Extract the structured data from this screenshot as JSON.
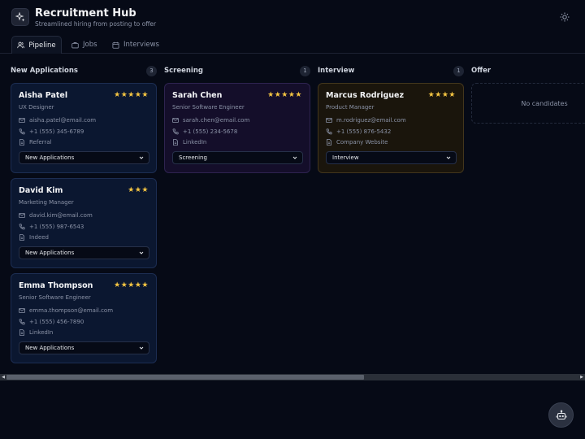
{
  "app": {
    "title": "Recruitment Hub",
    "subtitle": "Streamlined hiring from posting to offer"
  },
  "tabs": [
    {
      "label": "Pipeline",
      "active": true,
      "icon": "users-icon"
    },
    {
      "label": "Jobs",
      "active": false,
      "icon": "briefcase-icon"
    },
    {
      "label": "Interviews",
      "active": false,
      "icon": "calendar-icon"
    }
  ],
  "columns": [
    {
      "title": "New Applications",
      "count": "3"
    },
    {
      "title": "Screening",
      "count": "1"
    },
    {
      "title": "Interview",
      "count": "1"
    },
    {
      "title": "Offer",
      "empty_text": "No candidates"
    }
  ],
  "candidates": [
    {
      "name": "Aisha Patel",
      "role": "UX Designer",
      "email": "aisha.patel@email.com",
      "phone": "+1 (555) 345-6789",
      "source": "Referral",
      "stars": "★★★★★",
      "rating": 5,
      "stage": "New Applications"
    },
    {
      "name": "David Kim",
      "role": "Marketing Manager",
      "email": "david.kim@email.com",
      "phone": "+1 (555) 987-6543",
      "source": "Indeed",
      "stars": "★★★",
      "rating": 3,
      "stage": "New Applications"
    },
    {
      "name": "Emma Thompson",
      "role": "Senior Software Engineer",
      "email": "emma.thompson@email.com",
      "phone": "+1 (555) 456-7890",
      "source": "LinkedIn",
      "stars": "★★★★★",
      "rating": 5,
      "stage": "New Applications"
    },
    {
      "name": "Sarah Chen",
      "role": "Senior Software Engineer",
      "email": "sarah.chen@email.com",
      "phone": "+1 (555) 234-5678",
      "source": "LinkedIn",
      "stars": "★★★★★",
      "rating": 5,
      "stage": "Screening"
    },
    {
      "name": "Marcus Rodriguez",
      "role": "Product Manager",
      "email": "m.rodriguez@email.com",
      "phone": "+1 (555) 876-5432",
      "source": "Company Website",
      "stars": "★★★★",
      "rating": 4,
      "stage": "Interview"
    }
  ],
  "colors": {
    "background": "#060a16",
    "star": "#f5c542",
    "card_new": "#0b1730",
    "card_screening": "#140e2a",
    "card_interview": "#1a150c"
  }
}
